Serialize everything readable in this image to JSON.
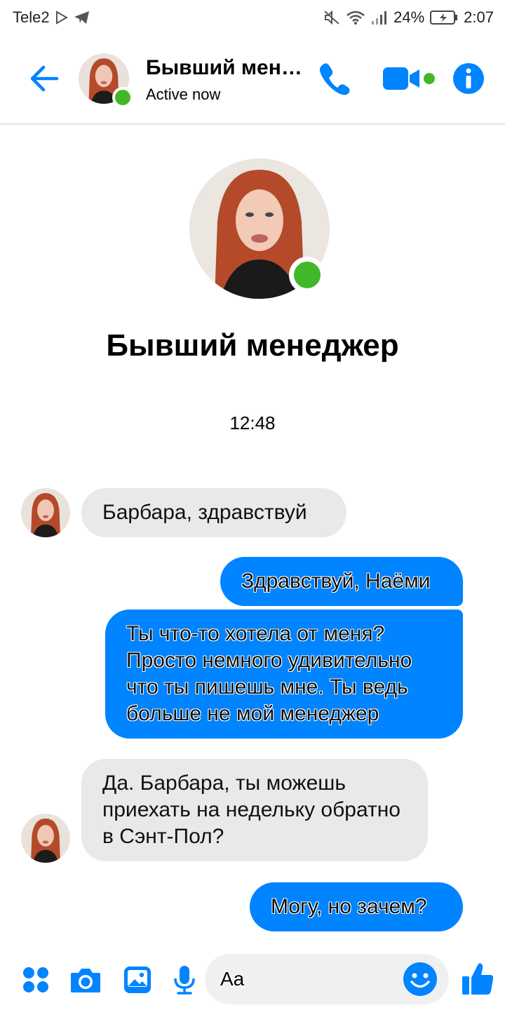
{
  "status_bar": {
    "carrier": "Tele2",
    "battery": "24%",
    "time": "2:07"
  },
  "header": {
    "contact_name": "Бывший менеджер",
    "status": "Active now"
  },
  "profile": {
    "name": "Бывший менеджер"
  },
  "conversation": {
    "timestamp": "12:48",
    "messages": [
      {
        "direction": "incoming",
        "text": "Барбара, здравствуй"
      },
      {
        "direction": "outgoing",
        "text": "Здравствуй, Наёми"
      },
      {
        "direction": "outgoing",
        "text": "Ты что-то хотела от меня? Просто немного удивительно что ты пишешь мне. Ты ведь больше не мой менеджер"
      },
      {
        "direction": "incoming",
        "text": "Да. Барбара, ты можешь приехать на недельку обратно в Сэнт-Пол?"
      },
      {
        "direction": "outgoing",
        "text": "Могу, но зачем?"
      }
    ]
  },
  "composer": {
    "placeholder": "Aa"
  },
  "colors": {
    "accent": "#0084ff",
    "online": "#42b72a",
    "incoming_bubble": "#e9e9eb"
  },
  "icons": [
    "back-arrow-icon",
    "phone-icon",
    "video-camera-icon",
    "info-icon",
    "menu-dots-icon",
    "camera-icon",
    "gallery-icon",
    "microphone-icon",
    "emoji-icon",
    "thumbs-up-icon"
  ]
}
